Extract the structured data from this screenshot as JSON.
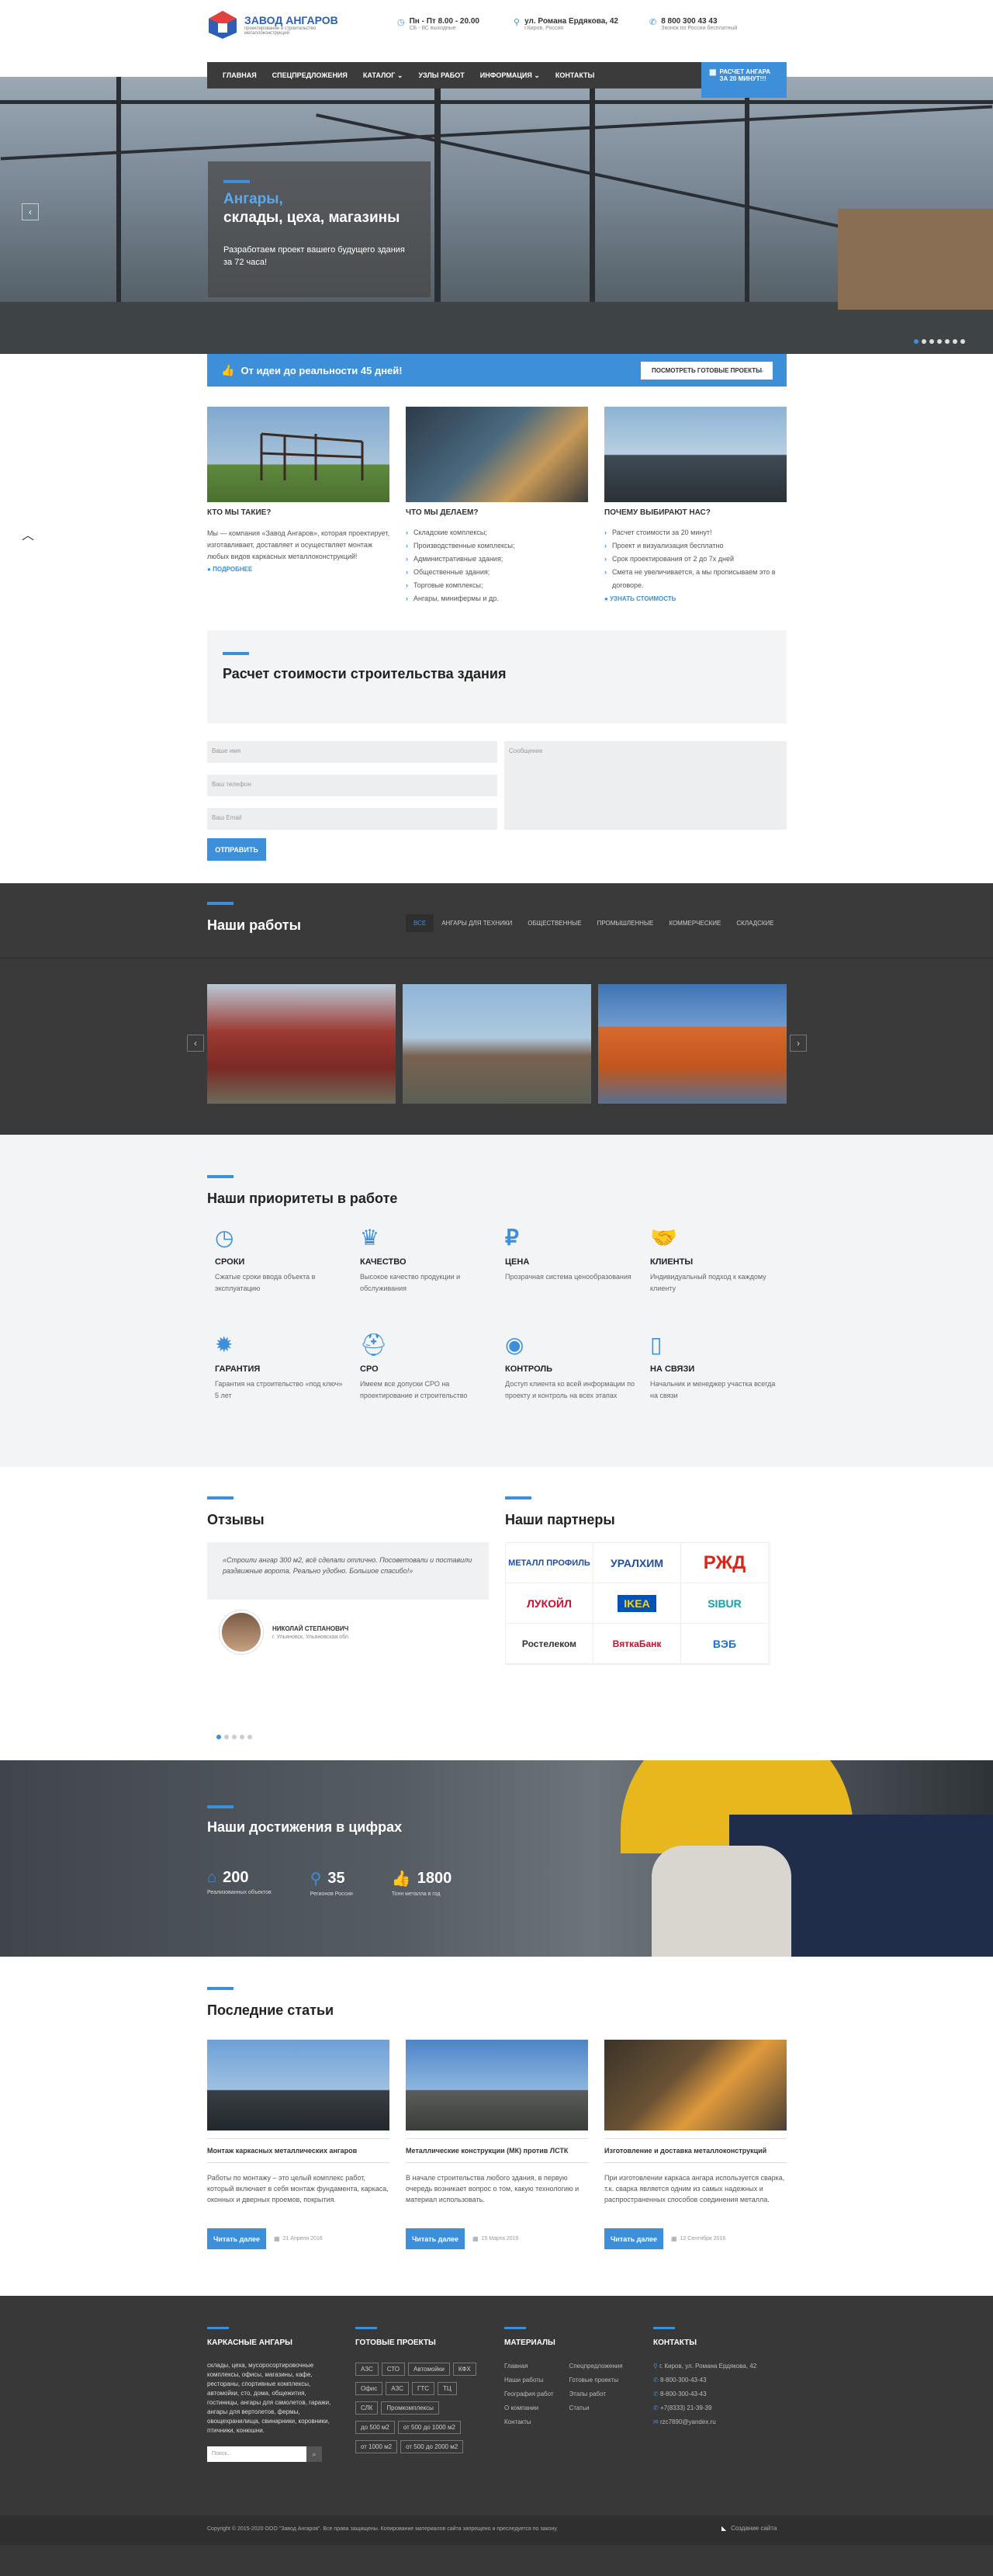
{
  "header": {
    "logo_title": "ЗАВОД АНГАРОВ",
    "logo_sub": "проектирование и строительство металлоконструкций",
    "hours": "Пн - Пт 8.00 - 20.00",
    "hours_sub": "СБ - ВС выходные",
    "address": "ул. Романа Ердякова, 42",
    "address_sub": "г.Киров, Россия",
    "phone": "8 800 300 43 43",
    "phone_sub": "Звонок по России бесплатный"
  },
  "nav": {
    "items": [
      "Главная",
      "Спецпредложения",
      "Каталог",
      "Узлы работ",
      "Информация",
      "Контакты"
    ],
    "cta_line1": "РАСЧЕТ АНГАРА",
    "cta_line2": "ЗА 20 МИНУТ!!!"
  },
  "hero": {
    "title_line1": "Ангары,",
    "title_line2": "склады, цеха, магазины",
    "text": "Разработаем проект вашего будущего здания за 72 часа!"
  },
  "banner": {
    "text": "От идеи до реальности 45 дней!",
    "button": "ПОСМОТРЕТЬ ГОТОВЫЕ ПРОЕКТЫ"
  },
  "cards": [
    {
      "title": "КТО МЫ ТАКИЕ?",
      "text": "Мы — компания «Завод Ангаров», которая проектирует, изготавливает, доставляет и осуществляет монтаж любых видов каркасных металлоконструкций!",
      "link": "ПОДРОБНЕЕ"
    },
    {
      "title": "ЧТО МЫ ДЕЛАЕМ?",
      "items": [
        "Складские комплексы;",
        "Производственные комплексы;",
        "Административные здания;",
        "Общественные здания;",
        "Торговые комплексы;",
        "Ангары, минифермы и др."
      ]
    },
    {
      "title": "ПОЧЕМУ ВЫБИРАЮТ НАС?",
      "items": [
        "Расчет стоимости за 20 минут!",
        "Проект и визуализация бесплатно",
        "Срок проектирования от 2 до 7х дней",
        "Смета не увеличивается, а мы прописываем это в договоре."
      ],
      "link": "УЗНАТЬ СТОИМОСТЬ"
    }
  ],
  "calc": {
    "title": "Расчет стоимости строительства здания",
    "name_ph": "Ваше имя",
    "phone_ph": "Ваш телефон",
    "email_ph": "Ваш Email",
    "msg_ph": "Сообщение",
    "submit": "ОТПРАВИТЬ"
  },
  "works": {
    "title": "Наши работы",
    "tabs": [
      "Все",
      "Ангары для техники",
      "Общественные",
      "Промышленные",
      "Коммерческие",
      "Складские"
    ]
  },
  "priorities": {
    "title": "Наши приоритеты в работе",
    "items": [
      {
        "title": "СРОКИ",
        "text": "Сжатые сроки ввода объекта в эксплуатацию"
      },
      {
        "title": "КАЧЕСТВО",
        "text": "Высокое качество продукции и обслуживания"
      },
      {
        "title": "ЦЕНА",
        "text": "Прозрачная система ценообразования"
      },
      {
        "title": "КЛИЕНТЫ",
        "text": "Индивидуальный подход к каждому клиенту"
      },
      {
        "title": "ГАРАНТИЯ",
        "text": "Гарантия на строительство «под ключ» 5 лет"
      },
      {
        "title": "СРО",
        "text": "Имеем все допуски СРО на проектирование и строительство"
      },
      {
        "title": "КОНТРОЛЬ",
        "text": "Доступ клиента ко всей информации по проекту и контроль на всех этапах"
      },
      {
        "title": "НА СВЯЗИ",
        "text": "Начальник и менеджер участка всегда на связи"
      }
    ]
  },
  "reviews": {
    "title": "Отзывы",
    "quote": "«Строили ангар 300 м2, всё сделали отлично. Посоветовали и поставили раздвижные ворота. Реально удобно. Большое спасибо!»",
    "author": "НИКОЛАЙ СТЕПАНОВИЧ",
    "author_place": "г. Ульяновск, Ульяновская обл."
  },
  "partners": {
    "title": "Наши партнеры",
    "items": [
      "МЕТАЛЛ ПРОФИЛЬ",
      "УРАЛХИМ",
      "РЖД",
      "ЛУКОЙЛ",
      "IKEA",
      "SIBUR",
      "Ростелеком",
      "ВяткаБанк",
      "ВЭБ"
    ]
  },
  "achievements": {
    "title": "Наши достижения в цифрах",
    "items": [
      {
        "value": "200",
        "label": "Реализованных объектов"
      },
      {
        "value": "35",
        "label": "Регионов России"
      },
      {
        "value": "1800",
        "label": "Тонн металла в год"
      }
    ]
  },
  "articles": {
    "title": "Последние статьи",
    "items": [
      {
        "title": "Монтаж каркасных металлических ангаров",
        "text": "Работы по монтажу – это целый комплекс работ, который включает в себя монтаж фундамента, каркаса, оконных и дверных проемов, покрытия.",
        "date": "21 Апреля 2016",
        "button": "Читать далее"
      },
      {
        "title": "Металлические конструкции (МК) против ЛСТК",
        "text": "В начале строительства любого здания, в первую очередь возникает вопрос о том, какую технологию и материал использовать.",
        "date": "15 Марта 2016",
        "button": "Читать далее"
      },
      {
        "title": "Изготовление и доставка металлоконструкций",
        "text": "При изготовлении каркаса ангара используется сварка, т.к. сварка является одним из самых надежных и распространенных способов соединения металла.",
        "date": "12 Сентября 2016",
        "button": "Читать далее"
      }
    ]
  },
  "footer": {
    "col1_title": "КАРКАСНЫЕ АНГАРЫ",
    "col1_text": "склады, цеха, мусоросортировочные комплексы, офисы, магазины, кафе, рестораны, спортивные комплексы, автомойки, сто, дома, общежития, гостиницы, ангары для самолетов, гаражи, ангары для вертолетов, фермы, овощехранилища, свинарники, коровники, птичники, конюшни.",
    "search_ph": "Поиск...",
    "col2_title": "ГОТОВЫЕ ПРОЕКТЫ",
    "tags": [
      "АЗС",
      "СТО",
      "Автомойки",
      "КФХ",
      "Офис",
      "АЗС",
      "ГТС",
      "ТЦ",
      "СЛК",
      "Промкомплексы",
      "до 500 м2",
      "от 500 до 1000 м2",
      "от 1000 м2",
      "от 500 до 2000 м2"
    ],
    "col3_title": "МАТЕРИАЛЫ",
    "links_a": [
      "Главная",
      "Наши работы",
      "География работ",
      "О компании",
      "Контакты"
    ],
    "links_b": [
      "Спецпредложения",
      "Готовые проекты",
      "Этапы работ",
      "Статьи"
    ],
    "col4_title": "КОНТАКТЫ",
    "contacts": [
      "г. Киров, ул. Романа Ердякова, 42",
      "8-800-300-43-43",
      "8-800-300-43-43",
      "+7(8333) 21-39-39",
      "rzc7890@yandex.ru"
    ],
    "copyright": "Copyright © 2015-2020 ООО \"Завод Ангаров\". Все права защищены. Копирование материалов сайта запрещено и преследуется по закону.",
    "dev": "Создание сайта"
  },
  "colors": {
    "accent": "#3d8fd9",
    "dark": "#3a3a3a"
  }
}
